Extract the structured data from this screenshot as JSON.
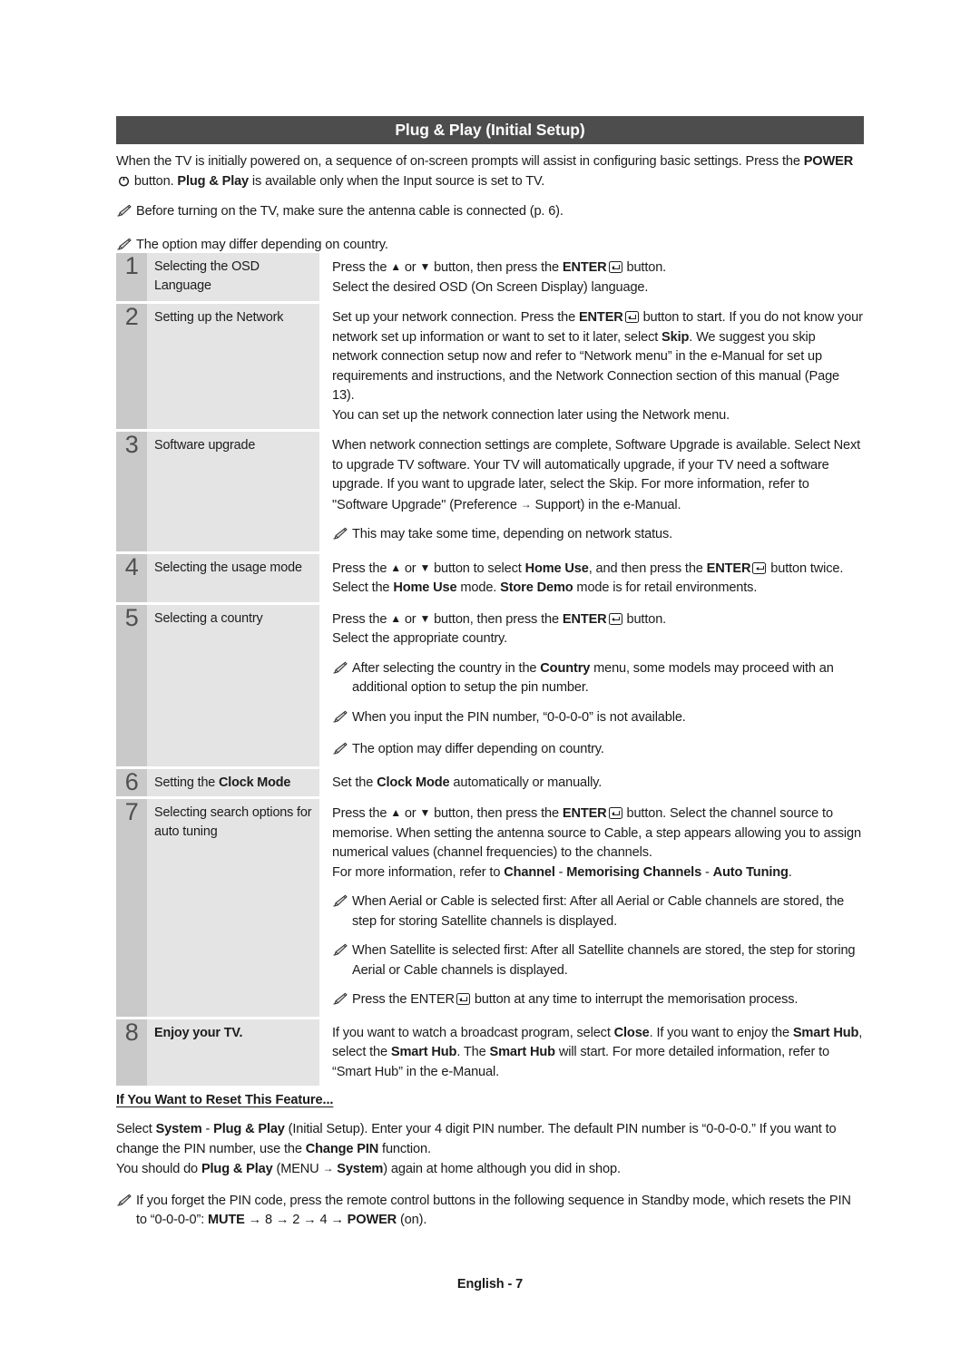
{
  "header": {
    "title": "Plug & Play (Initial Setup)"
  },
  "intro": {
    "paragraph_pre": "When the TV is initially powered on, a sequence of on-screen prompts will assist in configuring basic settings. Press the ",
    "power_label": "POWER",
    "paragraph_mid": " button. ",
    "plug_and_play": "Plug & Play",
    "paragraph_post": " is available only when the Input source is set to TV.",
    "notes": [
      "Before turning on the TV, make sure the antenna cable is connected (p. 6).",
      "The option may differ depending on country."
    ]
  },
  "steps": [
    {
      "number": "1",
      "label_plain": "Selecting the OSD Language",
      "lines": [
        {
          "segments": [
            {
              "t": "Press the "
            },
            {
              "t": "▲",
              "style": "glyph"
            },
            {
              "t": " or "
            },
            {
              "t": "▼",
              "style": "glyph"
            },
            {
              "t": " button, then press the "
            },
            {
              "t": "ENTER",
              "style": "bold"
            },
            {
              "t": "",
              "style": "enter-icon"
            },
            {
              "t": " button."
            }
          ]
        },
        {
          "segments": [
            {
              "t": "Select the desired OSD (On Screen Display) language."
            }
          ]
        }
      ],
      "notes": []
    },
    {
      "number": "2",
      "label_plain": "Setting up the Network",
      "lines": [
        {
          "segments": [
            {
              "t": "Set up your network connection. Press the "
            },
            {
              "t": "ENTER",
              "style": "bold"
            },
            {
              "t": "",
              "style": "enter-icon"
            },
            {
              "t": " button to start. If you do not know your network set up information or want to set to it later, select "
            },
            {
              "t": "Skip",
              "style": "bold"
            },
            {
              "t": ". We suggest you skip network connection setup now and refer to “Network menu” in the e-Manual for set up requirements and instructions, and the Network Connection section of this manual (Page 13)."
            }
          ]
        },
        {
          "segments": [
            {
              "t": "You can set up the network connection later using the Network menu."
            }
          ]
        }
      ],
      "notes": []
    },
    {
      "number": "3",
      "label_plain": "Software upgrade",
      "lines": [
        {
          "segments": [
            {
              "t": "When network connection settings are complete, Software Upgrade is available. Select Next to upgrade TV software. Your TV will automatically upgrade, if your TV need a software upgrade. If you want to upgrade later, select the Skip. For more information, refer to \"Software Upgrade\" (Preference "
            },
            {
              "t": "→",
              "style": "glyph"
            },
            {
              "t": " Support) in the e-Manual."
            }
          ]
        }
      ],
      "notes": [
        {
          "segments": [
            {
              "t": "This may take some time, depending on network status."
            }
          ]
        }
      ]
    },
    {
      "number": "4",
      "label_plain": "Selecting the usage mode",
      "lines": [
        {
          "segments": [
            {
              "t": "Press the "
            },
            {
              "t": "▲",
              "style": "glyph"
            },
            {
              "t": " or "
            },
            {
              "t": "▼",
              "style": "glyph"
            },
            {
              "t": " button to select "
            },
            {
              "t": "Home Use",
              "style": "bold"
            },
            {
              "t": ", and then press the "
            },
            {
              "t": "ENTER",
              "style": "bold"
            },
            {
              "t": "",
              "style": "enter-icon"
            },
            {
              "t": " button twice."
            }
          ]
        },
        {
          "segments": [
            {
              "t": "Select the "
            },
            {
              "t": "Home Use",
              "style": "bold"
            },
            {
              "t": " mode. "
            },
            {
              "t": "Store Demo",
              "style": "bold"
            },
            {
              "t": " mode is for retail environments."
            }
          ]
        }
      ],
      "notes": []
    },
    {
      "number": "5",
      "label_plain": "Selecting a country",
      "lines": [
        {
          "segments": [
            {
              "t": "Press the "
            },
            {
              "t": "▲",
              "style": "glyph"
            },
            {
              "t": " or "
            },
            {
              "t": "▼",
              "style": "glyph"
            },
            {
              "t": " button, then press the "
            },
            {
              "t": "ENTER",
              "style": "bold"
            },
            {
              "t": "",
              "style": "enter-icon"
            },
            {
              "t": " button."
            }
          ]
        },
        {
          "segments": [
            {
              "t": "Select the appropriate country."
            }
          ]
        }
      ],
      "notes": [
        {
          "segments": [
            {
              "t": "After selecting the country in the "
            },
            {
              "t": "Country",
              "style": "bold"
            },
            {
              "t": " menu, some models may proceed with an additional option to setup the pin number."
            }
          ]
        },
        {
          "segments": [
            {
              "t": "When you input the PIN number, “0-0-0-0” is not available."
            }
          ]
        },
        {
          "segments": [
            {
              "t": "The option may differ depending on country."
            }
          ]
        }
      ]
    },
    {
      "number": "6",
      "label_segments": [
        {
          "t": "Setting the "
        },
        {
          "t": "Clock Mode",
          "style": "bold"
        }
      ],
      "label_plain": "Setting the Clock Mode",
      "lines": [
        {
          "segments": [
            {
              "t": "Set the "
            },
            {
              "t": "Clock Mode",
              "style": "bold"
            },
            {
              "t": " automatically or manually."
            }
          ]
        }
      ],
      "notes": []
    },
    {
      "number": "7",
      "label_plain": "Selecting search options for auto tuning",
      "lines": [
        {
          "segments": [
            {
              "t": "Press the "
            },
            {
              "t": "▲",
              "style": "glyph"
            },
            {
              "t": " or "
            },
            {
              "t": "▼",
              "style": "glyph"
            },
            {
              "t": " button, then press the "
            },
            {
              "t": "ENTER",
              "style": "bold"
            },
            {
              "t": "",
              "style": "enter-icon"
            },
            {
              "t": " button. Select the channel source to memorise. When setting the antenna source to Cable, a step appears allowing you to assign numerical values (channel frequencies) to the channels."
            }
          ]
        },
        {
          "segments": [
            {
              "t": "For more information, refer to "
            },
            {
              "t": "Channel",
              "style": "bold"
            },
            {
              "t": " - "
            },
            {
              "t": "Memorising Channels",
              "style": "bold"
            },
            {
              "t": " - "
            },
            {
              "t": "Auto Tuning",
              "style": "bold"
            },
            {
              "t": "."
            }
          ]
        }
      ],
      "notes": [
        {
          "segments": [
            {
              "t": "When Aerial or Cable is selected first: After all Aerial or Cable channels are stored, the step for storing Satellite channels is displayed."
            }
          ]
        },
        {
          "segments": [
            {
              "t": "When Satellite is selected first: After all Satellite channels are stored, the step for storing Aerial or Cable channels is displayed."
            }
          ]
        },
        {
          "segments": [
            {
              "t": "Press the "
            },
            {
              "t": "ENTER",
              "style": "plain"
            },
            {
              "t": "",
              "style": "enter-icon"
            },
            {
              "t": " button at any time to interrupt the memorisation process."
            }
          ]
        }
      ]
    },
    {
      "number": "8",
      "label_segments": [
        {
          "t": "Enjoy your TV.",
          "style": "bold"
        }
      ],
      "label_plain": "Enjoy your TV.",
      "lines": [
        {
          "segments": [
            {
              "t": "If you want to watch a broadcast program, select "
            },
            {
              "t": "Close",
              "style": "bold"
            },
            {
              "t": ". If you want to enjoy the "
            },
            {
              "t": "Smart Hub",
              "style": "bold"
            },
            {
              "t": ", select the "
            },
            {
              "t": "Smart Hub",
              "style": "bold"
            },
            {
              "t": ". The "
            },
            {
              "t": "Smart Hub",
              "style": "bold"
            },
            {
              "t": " will start. For more detailed information, refer to “Smart Hub” in the e-Manual."
            }
          ]
        }
      ],
      "notes": []
    }
  ],
  "reset": {
    "heading": "If You Want to Reset This Feature...",
    "paragraph1": [
      {
        "t": "Select "
      },
      {
        "t": "System",
        "style": "bold"
      },
      {
        "t": " - "
      },
      {
        "t": "Plug & Play",
        "style": "bold"
      },
      {
        "t": " (Initial Setup). Enter your 4 digit PIN number. The default PIN number is “0-0-0-0.” If you want to change the PIN number, use the "
      },
      {
        "t": "Change PIN",
        "style": "bold"
      },
      {
        "t": " function."
      }
    ],
    "paragraph2": [
      {
        "t": "You should do "
      },
      {
        "t": "Plug & Play",
        "style": "bold"
      },
      {
        "t": " (MENU "
      },
      {
        "t": "→",
        "style": "glyph"
      },
      {
        "t": " "
      },
      {
        "t": "System",
        "style": "bold"
      },
      {
        "t": ") again at home although you did in shop."
      }
    ],
    "note": [
      {
        "t": "If you forget the PIN code, press the remote control buttons in the following sequence in Standby mode, which resets the PIN to “0-0-0-0”: "
      },
      {
        "t": "MUTE",
        "style": "bold"
      },
      {
        "t": " → 8 → 2 → 4 → "
      },
      {
        "t": "POWER",
        "style": "bold"
      },
      {
        "t": " (on)."
      }
    ]
  },
  "footer": {
    "text": "English - 7"
  },
  "colors": {
    "title_bar_bg": "#4d4d4d",
    "step_number_bg": "#c9c9c9",
    "step_label_bg": "#e4e4e4",
    "text": "#1c1c1c",
    "page_bg": "#ffffff"
  }
}
